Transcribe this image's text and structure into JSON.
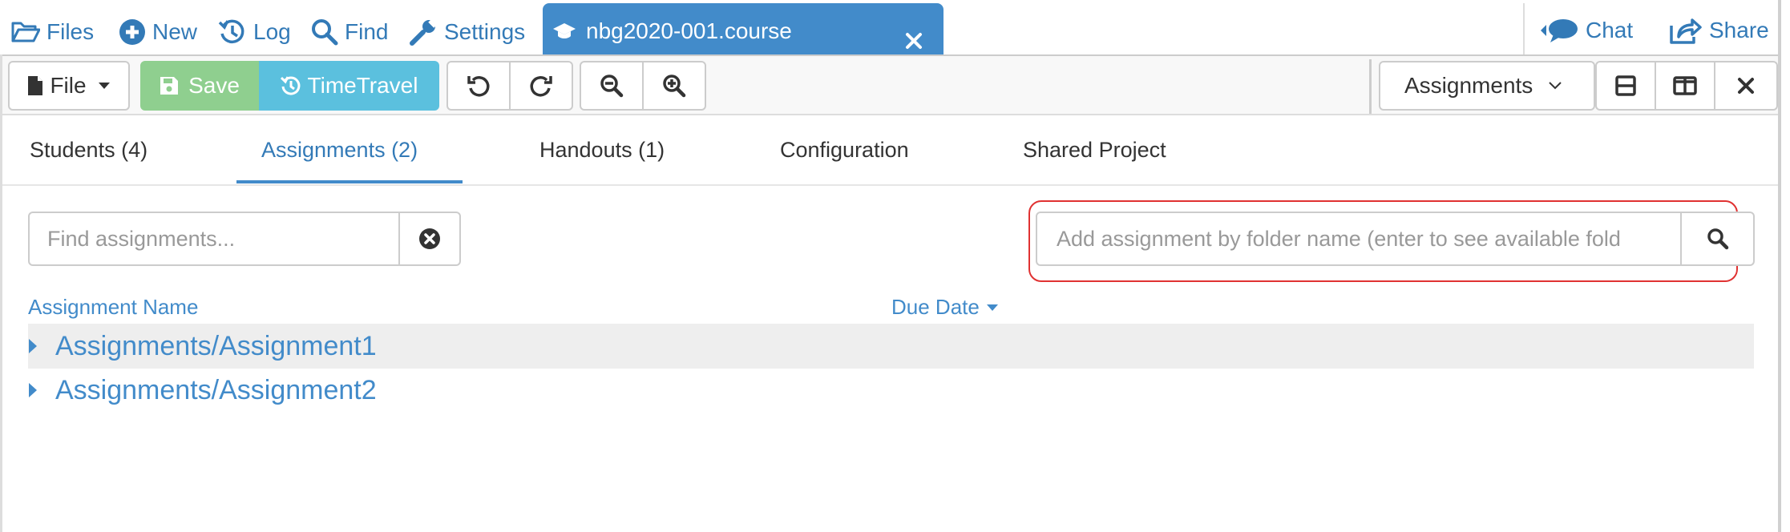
{
  "topnav": {
    "files": "Files",
    "new": "New",
    "log": "Log",
    "find": "Find",
    "settings": "Settings",
    "active_tab": "nbg2020-001.course",
    "chat": "Chat",
    "share": "Share"
  },
  "toolbar": {
    "file": "File",
    "save": "Save",
    "timetravel": "TimeTravel",
    "view_select": "Assignments"
  },
  "tabs": [
    "Students (4)",
    "Assignments (2)",
    "Handouts (1)",
    "Configuration",
    "Shared Project"
  ],
  "search": {
    "placeholder": "Find assignments...",
    "value": ""
  },
  "add_assignment": {
    "placeholder": "Add assignment by folder name (enter to see available fold",
    "value": ""
  },
  "table": {
    "col_name": "Assignment Name",
    "col_due": "Due Date",
    "rows": [
      "Assignments/Assignment1",
      "Assignments/Assignment2"
    ]
  },
  "colors": {
    "brand": "#428bca",
    "link": "#337ab7",
    "save": "#8fcf8f",
    "timetravel": "#5bc0de",
    "highlight": "#e03232"
  }
}
